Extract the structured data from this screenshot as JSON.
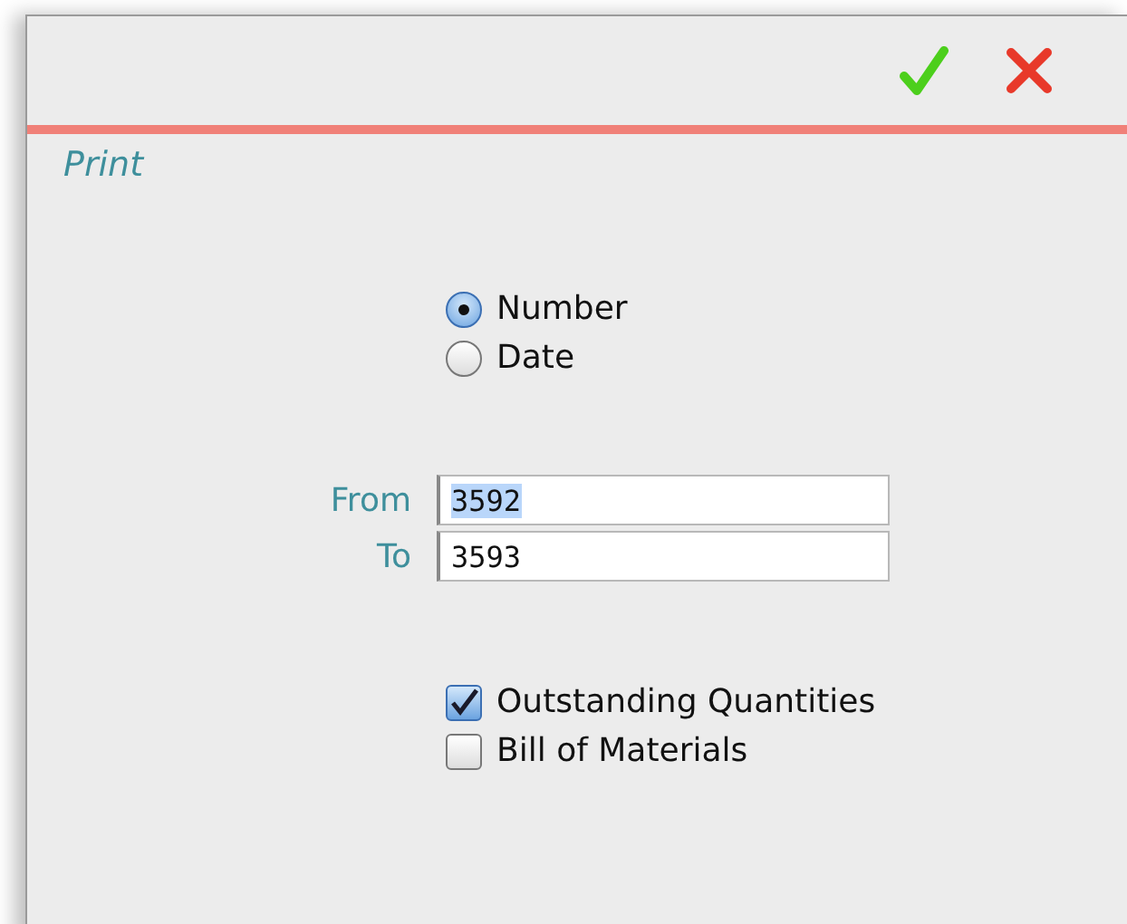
{
  "toolbar": {
    "buttons": [
      {
        "kind": "confirm"
      },
      {
        "kind": "cancel"
      }
    ]
  },
  "section_title": "Print",
  "sort_by": [
    {
      "label": "Number",
      "selected": true
    },
    {
      "label": "Date",
      "selected": false
    }
  ],
  "range": [
    {
      "label": "From",
      "value": "3592",
      "text_highlighted": true
    },
    {
      "label": "To",
      "value": "3593",
      "text_highlighted": false
    }
  ],
  "options": [
    {
      "label": "Outstanding Quantities",
      "checked": true
    },
    {
      "label": "Bill of Materials",
      "checked": false
    }
  ]
}
